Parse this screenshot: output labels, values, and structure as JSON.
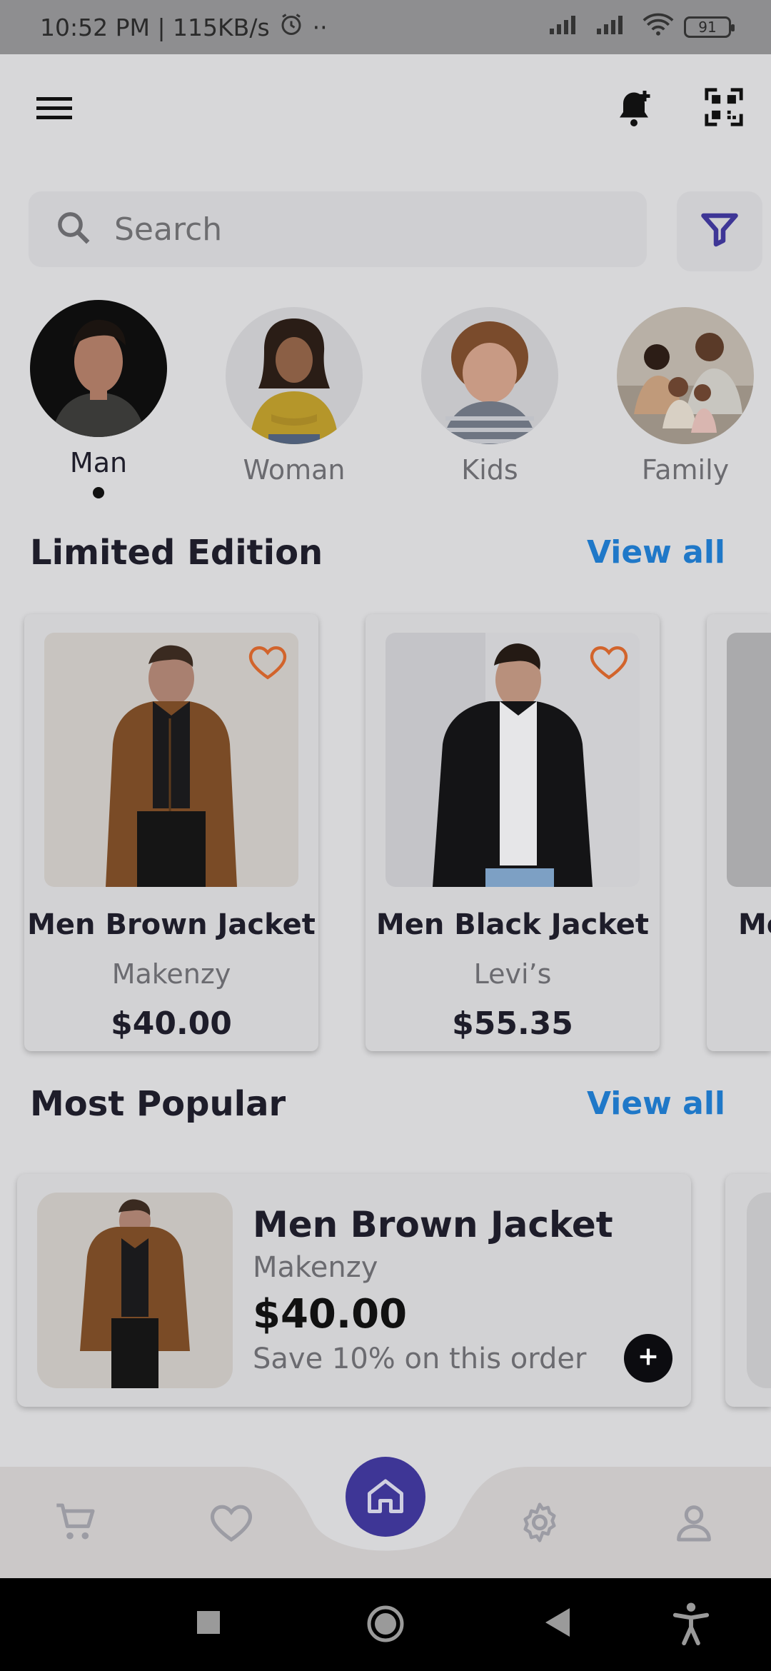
{
  "status_bar": {
    "time_speed": "10:52 PM | 115KB/s",
    "dots": "··",
    "battery": "91"
  },
  "search": {
    "placeholder": "Search"
  },
  "categories": [
    {
      "label": "Man",
      "active": true
    },
    {
      "label": "Woman",
      "active": false
    },
    {
      "label": "Kids",
      "active": false
    },
    {
      "label": "Family",
      "active": false
    }
  ],
  "limited_edition": {
    "title": "Limited Edition",
    "view_all": "View all",
    "products": [
      {
        "name": "Men Brown Jacket",
        "brand": "Makenzy",
        "price": "$40.00"
      },
      {
        "name": "Men Black Jacket",
        "brand": "Levi’s",
        "price": "$55.35"
      },
      {
        "name": "Me",
        "brand": "",
        "price": ""
      }
    ]
  },
  "most_popular": {
    "title": "Most Popular",
    "view_all": "View all",
    "product": {
      "name": "Men Brown Jacket",
      "brand": "Makenzy",
      "price": "$40.00",
      "promo": "Save 10% on this order"
    }
  },
  "colors": {
    "accent": "#3e3696",
    "link": "#1f78c8",
    "heart": "#d2642c"
  },
  "bottom_nav": [
    "cart-icon",
    "heart-icon",
    "home-icon",
    "settings-icon",
    "profile-icon"
  ]
}
